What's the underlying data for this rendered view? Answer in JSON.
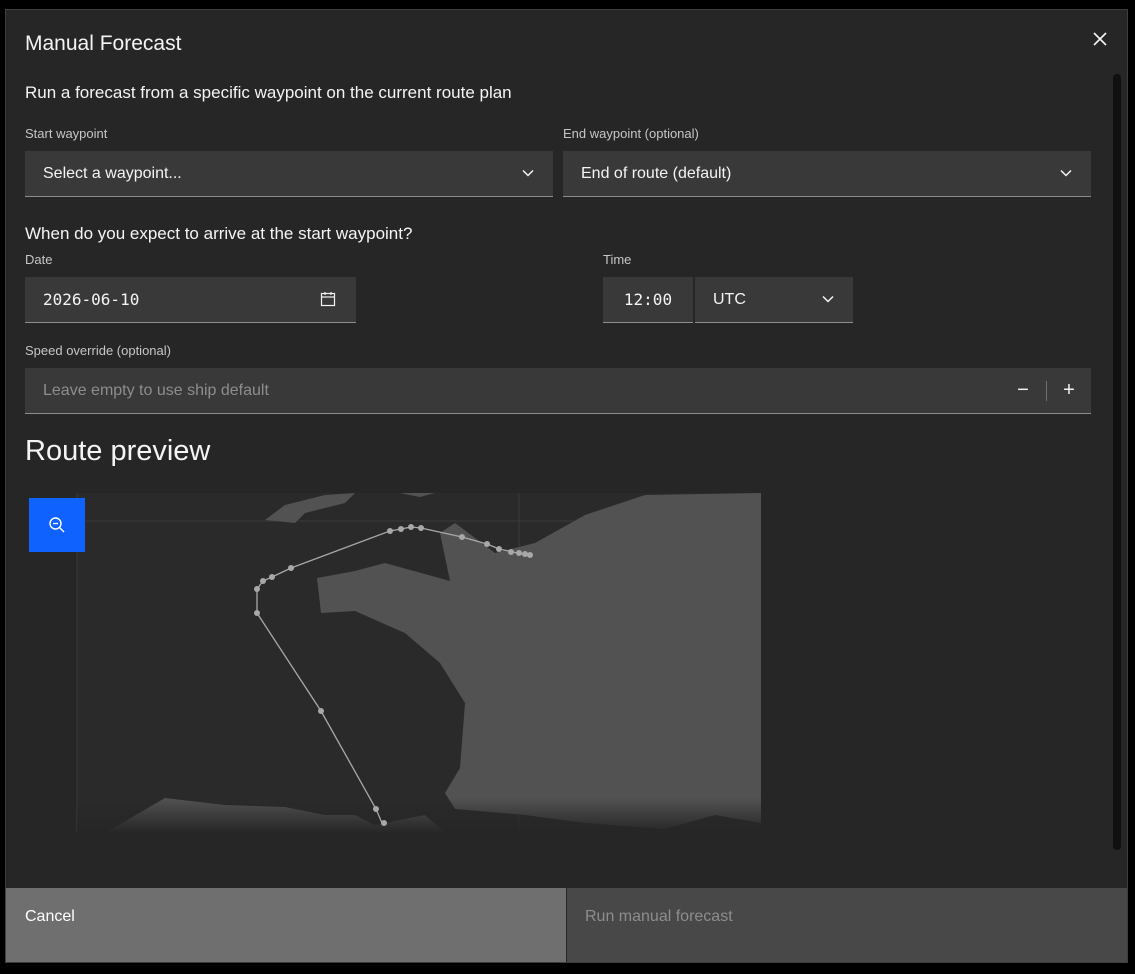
{
  "modal": {
    "title": "Manual Forecast",
    "subtitle": "Run a forecast from a specific waypoint on the current route plan"
  },
  "start_waypoint": {
    "label": "Start waypoint",
    "value": "Select a waypoint..."
  },
  "end_waypoint": {
    "label": "End waypoint (optional)",
    "value": "End of route (default)"
  },
  "arrival": {
    "question": "When do you expect to arrive at the start waypoint?",
    "date_label": "Date",
    "date_value": "2026-06-10",
    "time_label": "Time",
    "time_value": "12:00",
    "timezone_value": "UTC"
  },
  "speed": {
    "label": "Speed override (optional)",
    "placeholder": "Leave empty to use ship default",
    "decrement": "−",
    "increment": "+"
  },
  "preview": {
    "title": "Route preview"
  },
  "footer": {
    "cancel_label": "Cancel",
    "run_label": "Run manual forecast"
  },
  "colors": {
    "primary": "#0f62fe",
    "modal_bg": "#262626",
    "field_bg": "#393939",
    "land": "#525252",
    "route": "#a8a8a8"
  },
  "icons": {
    "close": "close-icon",
    "chevron": "chevron-down-icon",
    "calendar": "calendar-icon",
    "zoom": "zoom-out-icon"
  }
}
